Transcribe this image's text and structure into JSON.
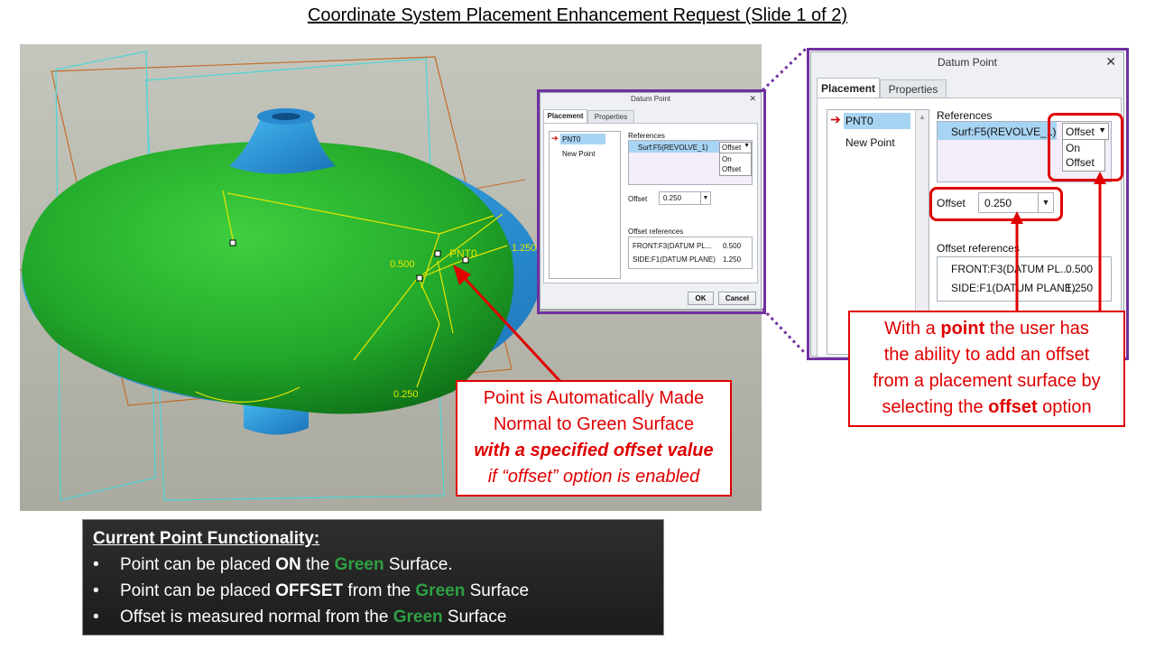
{
  "slide_title": "Coordinate System Placement Enhancement Request (Slide 1 of 2)",
  "viewport": {
    "label_pnt": "PNT0",
    "label_0500": "0.500",
    "label_1250": "1.250",
    "label_0250": "0.250"
  },
  "small_dialog": {
    "title": "Datum Point",
    "close": "✕",
    "tabs": [
      "Placement",
      "Properties"
    ],
    "points": [
      "PNT0",
      "New Point"
    ],
    "references_label": "References",
    "reference": "Surf:F5(REVOLVE_1)",
    "ref_type": "Offset",
    "dropdown_options": [
      "On",
      "Offset"
    ],
    "offset_label": "Offset",
    "offset_value": "0.250",
    "offset_refs_label": "Offset references",
    "offset_refs": [
      {
        "name": "FRONT:F3(DATUM PL...",
        "value": "0.500"
      },
      {
        "name": "SIDE:F1(DATUM PLANE)",
        "value": "1.250"
      }
    ],
    "ok": "OK",
    "cancel": "Cancel"
  },
  "large_dialog": {
    "title": "Datum Point",
    "close": "✕",
    "tabs": [
      "Placement",
      "Properties"
    ],
    "points": [
      "PNT0",
      "New Point"
    ],
    "references_label": "References",
    "reference": "Surf:F5(REVOLVE_1)",
    "ref_type": "Offset",
    "dropdown_options": [
      "On",
      "Offset"
    ],
    "offset_label": "Offset",
    "offset_value": "0.250",
    "offset_refs_label": "Offset references",
    "offset_refs": [
      {
        "name": "FRONT:F3(DATUM PL...",
        "value": "0.500"
      },
      {
        "name": "SIDE:F1(DATUM PLANE)",
        "value": "1.250"
      }
    ]
  },
  "callout_left": {
    "line1": "Point is Automatically Made",
    "line2": "Normal to Green Surface",
    "line3": "with a specified offset value",
    "line4": "if “offset” option is enabled"
  },
  "callout_right": {
    "l1a": "With a ",
    "l1b": "point",
    "l1c": " the user has",
    "l2": "the ability to add an offset",
    "l3": "from a placement surface by",
    "l4a": "selecting the ",
    "l4b": "offset",
    "l4c": " option"
  },
  "info": {
    "heading": "Current Point Functionality:",
    "bullet": "•",
    "b1a": "Point can be placed ",
    "b1b": "ON",
    "b1c": " the ",
    "b1d": "Green",
    "b1e": " Surface.",
    "b2a": "Point can be placed ",
    "b2b": "OFFSET",
    "b2c": " from the ",
    "b2d": "Green",
    "b2e": " Surface",
    "b3a": "Offset is measured normal from the ",
    "b3b": "Green",
    "b3c": " Surface"
  },
  "colors": {
    "purple": "#7030a0",
    "red": "#e00000",
    "green": "#2ea043",
    "yellow": "#e6e600"
  }
}
